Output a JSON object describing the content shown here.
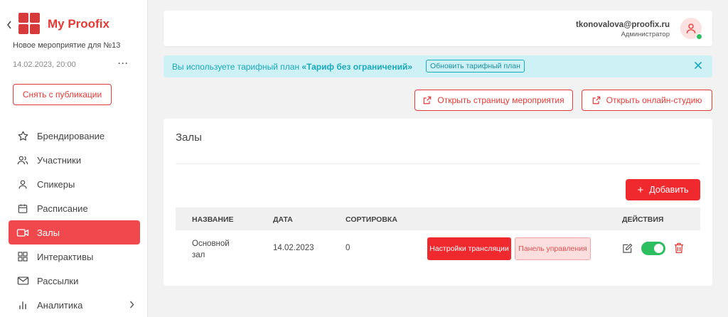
{
  "sidebar": {
    "app_title": "My Proofix",
    "event_name": "Новое мероприятие для №13",
    "event_date": "14.02.2023, 20:00",
    "more": "···",
    "unpublish_label": "Снять с публикации",
    "items": [
      {
        "label": "Брендирование",
        "icon": "star-icon"
      },
      {
        "label": "Участники",
        "icon": "users-icon"
      },
      {
        "label": "Спикеры",
        "icon": "user-icon"
      },
      {
        "label": "Расписание",
        "icon": "calendar-icon"
      },
      {
        "label": "Залы",
        "icon": "video-icon",
        "active": true
      },
      {
        "label": "Интерактивы",
        "icon": "grid-icon"
      },
      {
        "label": "Рассылки",
        "icon": "mail-icon"
      },
      {
        "label": "Аналитика",
        "icon": "bar-chart-icon"
      }
    ]
  },
  "header": {
    "email": "tkonovalova@proofix.ru",
    "role": "Администратор"
  },
  "banner": {
    "text": "Вы используете тарифный план ",
    "plan": "«Тариф без ограничений»",
    "upgrade_label": "Обновить тарифный план"
  },
  "actions": {
    "open_event_page": "Открыть страницу мероприятия",
    "open_studio": "Открыть онлайн-студию"
  },
  "halls": {
    "title": "Залы",
    "add_label": "Добавить",
    "columns": [
      "НАЗВАНИЕ",
      "ДАТА",
      "СОРТИРОВКА",
      "ДЕЙСТВИЯ"
    ],
    "rows": [
      {
        "name": "Основной зал",
        "date": "14.02.2023",
        "sort": "0",
        "stream_settings": "Настройки трансляции",
        "control_panel": "Панель управления",
        "enabled": true
      }
    ]
  },
  "colors": {
    "accent": "#f0292f",
    "active_nav": "#f0484c",
    "banner_bg": "#cdf1f5",
    "toggle_on": "#2dbe60"
  }
}
